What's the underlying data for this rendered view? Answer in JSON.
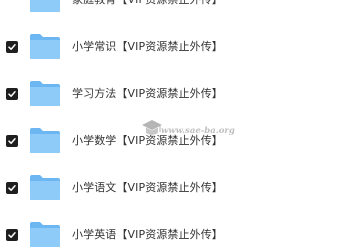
{
  "files": [
    {
      "name": "家庭教育【VIP资源禁止外传】",
      "checked": false
    },
    {
      "name": "小学常识【VIP资源禁止外传】",
      "checked": true
    },
    {
      "name": "学习方法【VIP资源禁止外传】",
      "checked": true
    },
    {
      "name": "小学数学【VIP资源禁止外传】",
      "checked": true
    },
    {
      "name": "小学语文【VIP资源禁止外传】",
      "checked": true
    },
    {
      "name": "小学英语【VIP资源禁止外传】",
      "checked": true
    }
  ],
  "watermark": {
    "text": "www.sae-ba.org"
  },
  "colors": {
    "folder_back": "#6cb6f2",
    "folder_front": "#8fcbf8",
    "checkbox": "#1f1f1f",
    "text": "#333333"
  },
  "icons": {
    "checkbox": "checkbox-checked-icon",
    "folder": "folder-icon",
    "watermark": "graduation-cap-icon"
  }
}
